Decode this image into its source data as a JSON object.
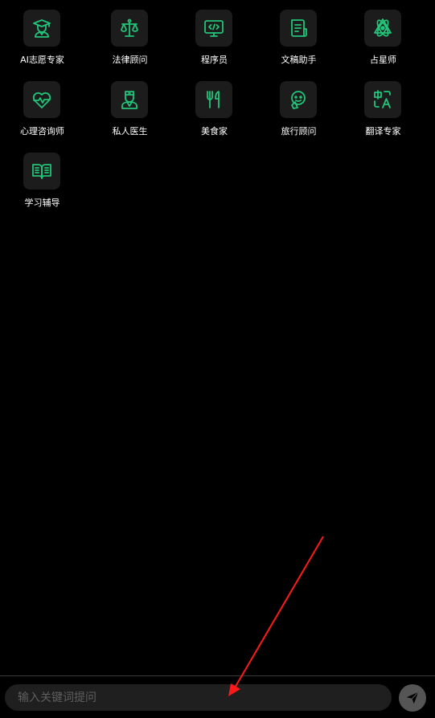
{
  "theme": {
    "background": "#000000",
    "icon_color": "#22c47a",
    "tile_color": "#1c1c1c",
    "label_color": "#ffffff",
    "annotation_arrow_color": "#ff1a1a"
  },
  "assistants": [
    {
      "label": "AI志愿专家",
      "icon": "graduate-icon"
    },
    {
      "label": "法律顾问",
      "icon": "scale-icon"
    },
    {
      "label": "程序员",
      "icon": "code-monitor-icon"
    },
    {
      "label": "文稿助手",
      "icon": "document-icon"
    },
    {
      "label": "占星师",
      "icon": "atom-star-icon"
    },
    {
      "label": "心理咨询师",
      "icon": "heartbeat-icon"
    },
    {
      "label": "私人医生",
      "icon": "doctor-icon"
    },
    {
      "label": "美食家",
      "icon": "utensils-icon"
    },
    {
      "label": "旅行顾问",
      "icon": "traveler-icon"
    },
    {
      "label": "翻译专家",
      "icon": "translate-icon"
    },
    {
      "label": "学习辅导",
      "icon": "open-book-icon"
    }
  ],
  "search": {
    "placeholder": "输入关键词提问",
    "value": ""
  },
  "send": {
    "icon": "paper-plane-icon"
  }
}
